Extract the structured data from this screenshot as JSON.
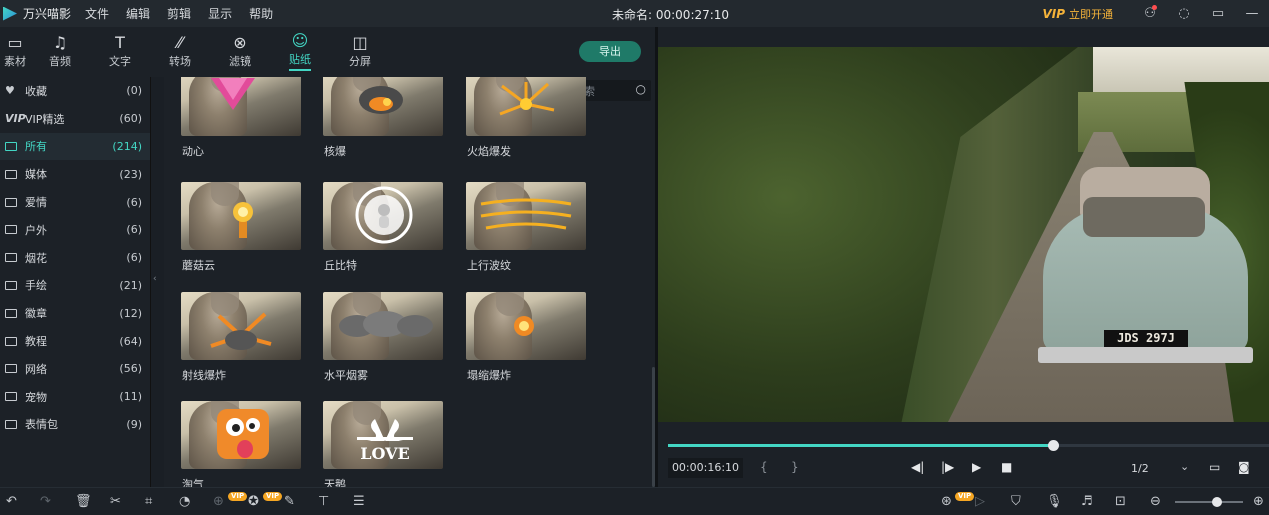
{
  "titlebar": {
    "app_name": "万兴喵影",
    "menu": [
      "文件",
      "编辑",
      "剪辑",
      "显示",
      "帮助"
    ],
    "doc_title": "未命名: 00:00:27:10",
    "vip_badge": "VIP",
    "vip_label": "立即开通"
  },
  "tabs": [
    {
      "label": "素材",
      "icon": "media-box-icon"
    },
    {
      "label": "音频",
      "icon": "music-note-icon"
    },
    {
      "label": "文字",
      "icon": "text-icon"
    },
    {
      "label": "转场",
      "icon": "transition-icon"
    },
    {
      "label": "滤镜",
      "icon": "filter-icon"
    },
    {
      "label": "贴纸",
      "icon": "sticker-icon",
      "active": true
    },
    {
      "label": "分屏",
      "icon": "split-screen-icon"
    }
  ],
  "export_label": "导出",
  "sidebar": {
    "items": [
      {
        "label": "收藏",
        "count": "(0)",
        "icon": "heart-icon"
      },
      {
        "label": "VIP精选",
        "count": "(60)",
        "icon": "vip-icon",
        "vip_text": "VIP"
      },
      {
        "label": "所有",
        "count": "(214)",
        "icon": "folder-icon",
        "active": true
      },
      {
        "label": "媒体",
        "count": "(23)",
        "icon": "folder-icon"
      },
      {
        "label": "爱情",
        "count": "(6)",
        "icon": "folder-icon"
      },
      {
        "label": "户外",
        "count": "(6)",
        "icon": "folder-icon"
      },
      {
        "label": "烟花",
        "count": "(6)",
        "icon": "folder-icon"
      },
      {
        "label": "手绘",
        "count": "(21)",
        "icon": "folder-icon"
      },
      {
        "label": "徽章",
        "count": "(12)",
        "icon": "folder-icon"
      },
      {
        "label": "教程",
        "count": "(64)",
        "icon": "folder-icon"
      },
      {
        "label": "网络",
        "count": "(56)",
        "icon": "folder-icon"
      },
      {
        "label": "宠物",
        "count": "(11)",
        "icon": "folder-icon"
      },
      {
        "label": "表情包",
        "count": "(9)",
        "icon": "folder-icon"
      }
    ]
  },
  "search": {
    "placeholder": "搜索"
  },
  "stickers": [
    {
      "name": "动心"
    },
    {
      "name": "核爆"
    },
    {
      "name": "火焰爆发"
    },
    {
      "name": "蘑菇云"
    },
    {
      "name": "丘比特"
    },
    {
      "name": "上行波纹"
    },
    {
      "name": "射线爆炸"
    },
    {
      "name": "水平烟雾"
    },
    {
      "name": "塌缩爆炸"
    },
    {
      "name": "淘气"
    },
    {
      "name": "天鹅"
    }
  ],
  "sticker_text": {
    "love": "LOVE"
  },
  "preview": {
    "plate": "JDS 297J",
    "timecode": "00:00:16:10",
    "mark_in": "{",
    "mark_out": "}",
    "ratio": "1/2",
    "progress": 0.64
  },
  "zoom_level": 0.62,
  "colors": {
    "accent": "#43d6c4",
    "vip": "#f5b33a",
    "background": "#1c2127"
  }
}
